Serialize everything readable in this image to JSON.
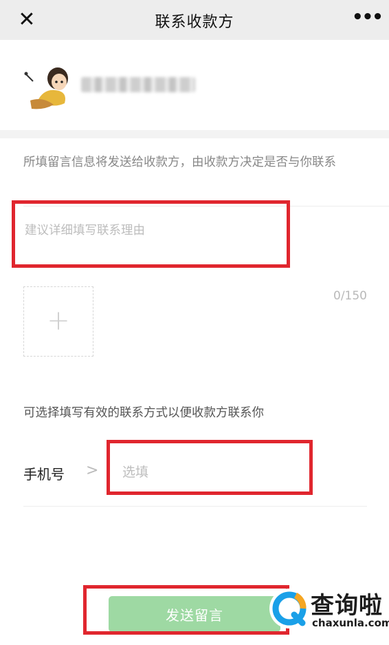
{
  "nav": {
    "close_icon": "close-icon",
    "title": "联系收款方",
    "more_icon": "more-icon"
  },
  "payee": {
    "avatar_icon": "cartoon-avatar",
    "name_blurred": true
  },
  "notice": "所填留言信息将发送给收款方，由收款方决定是否与你联系",
  "message": {
    "placeholder": "建议详细填写联系理由",
    "value": "",
    "add_image_icon": "plus-icon",
    "char_count": "0/150"
  },
  "contact": {
    "tip": "可选择填写有效的联系方式以便收款方联系你",
    "phone_label": "手机号",
    "phone_chevron": ">",
    "phone_placeholder": "选填",
    "phone_value": ""
  },
  "send_button": "发送留言",
  "highlight_color": "#e0262e",
  "button_color": "#9ed9a3",
  "watermark": {
    "cn": "查询啦",
    "en": "chaxunla.com"
  }
}
